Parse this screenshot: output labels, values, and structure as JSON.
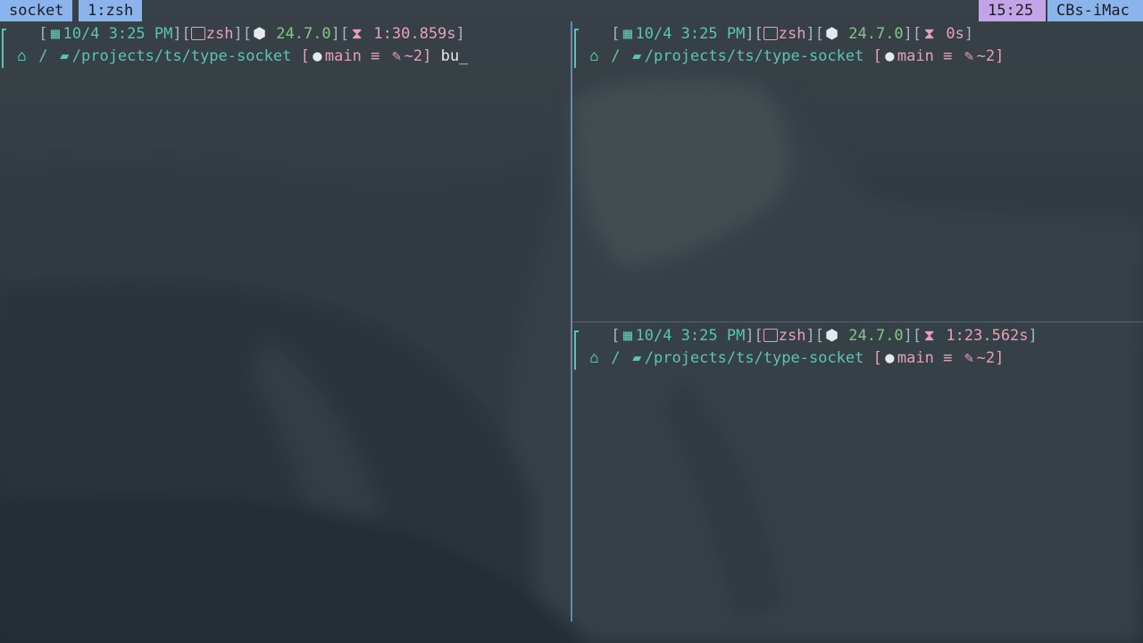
{
  "status_bar": {
    "session": "socket",
    "window": "1:zsh",
    "time": "15:25",
    "host": "CBs-iMac"
  },
  "panes": [
    {
      "date": "10/4 3:25 PM",
      "shell": "zsh",
      "node_version": "24.7.0",
      "duration": "1:30.859s",
      "root": "/",
      "path": "/projects/ts/type-socket",
      "branch": "main",
      "git_sync": "≡",
      "git_changes": "~2",
      "input": "bu_"
    },
    {
      "date": "10/4 3:25 PM",
      "shell": "zsh",
      "node_version": "24.7.0",
      "duration": "0s",
      "root": "/",
      "path": "/projects/ts/type-socket",
      "branch": "main",
      "git_sync": "≡",
      "git_changes": "~2",
      "input": ""
    },
    {
      "date": "10/4 3:25 PM",
      "shell": "zsh",
      "node_version": "24.7.0",
      "duration": "1:23.562s",
      "root": "/",
      "path": "/projects/ts/type-socket",
      "branch": "main",
      "git_sync": "≡",
      "git_changes": "~2",
      "input": ""
    }
  ],
  "icons": {
    "os": "apple-icon",
    "date": "calendar-icon",
    "shell": "terminal-icon",
    "runtime": "node-icon",
    "timer": "hourglass-icon",
    "home": "home-icon",
    "folder": "folder-icon",
    "vcs": "github-icon",
    "changes": "edit-icon"
  },
  "colors": {
    "status_accent": "#8cb4ec",
    "status_time": "#c4a4e8",
    "prompt_teal": "#5ec4b0",
    "prompt_pink": "#e8a0b8",
    "prompt_green": "#86c68a",
    "pane_divider": "#7d9ed8"
  }
}
